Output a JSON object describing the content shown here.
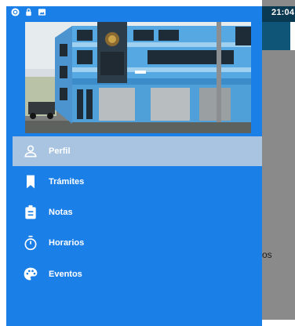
{
  "status_bar": {
    "time": "21:04",
    "icons": [
      "sync-icon",
      "lock-icon",
      "image-icon"
    ]
  },
  "drawer": {
    "header_image": "building-photo",
    "items": [
      {
        "label": "Perfil",
        "icon": "person-icon",
        "selected": true
      },
      {
        "label": "Trámites",
        "icon": "bookmark-icon",
        "selected": false
      },
      {
        "label": "Notas",
        "icon": "clipboard-icon",
        "selected": false
      },
      {
        "label": "Horarios",
        "icon": "timer-icon",
        "selected": false
      },
      {
        "label": "Eventos",
        "icon": "palette-icon",
        "selected": false
      }
    ]
  },
  "background_app": {
    "visible_text": "os",
    "overflow_menu_icon": "more-vert-icon"
  },
  "colors": {
    "drawer": "#1b7fe8",
    "selected_item": "#a8c4e0",
    "toolbar": "#0f5577",
    "status_bar": "#0a3a52",
    "scrim": "#8a8a8a"
  }
}
